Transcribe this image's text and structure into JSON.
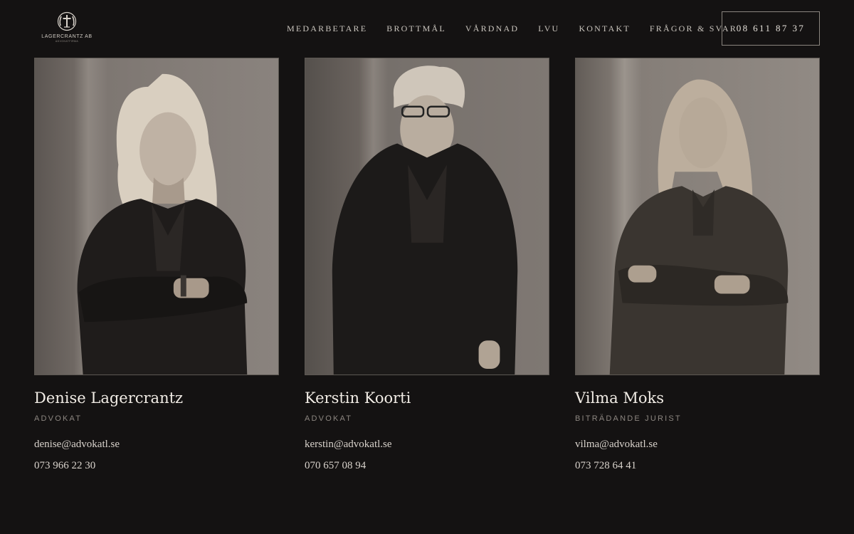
{
  "logo": {
    "name": "LAGERCRANTZ AB",
    "sub": "ADVOKATFIRMA",
    "icon": "laurel-cross-icon"
  },
  "nav": {
    "items": [
      {
        "label": "MEDARBETARE"
      },
      {
        "label": "BROTTMÅL"
      },
      {
        "label": "VÅRDNAD"
      },
      {
        "label": "LVU"
      },
      {
        "label": "KONTAKT"
      },
      {
        "label": "FRÅGOR & SVAR"
      }
    ]
  },
  "header": {
    "phone": "08 611 87 37"
  },
  "people": [
    {
      "name": "Denise Lagercrantz",
      "role": "ADVOKAT",
      "email": "denise@advokatl.se",
      "phone": "073 966 22 30"
    },
    {
      "name": "Kerstin Koorti",
      "role": "ADVOKAT",
      "email": "kerstin@advokatl.se",
      "phone": "070 657 08 94"
    },
    {
      "name": "Vilma Moks",
      "role": "BITRÄDANDE JURIST",
      "email": "vilma@advokatl.se",
      "phone": "073 728 64 41"
    }
  ],
  "colors": {
    "background": "#141212",
    "text": "#f1ece5",
    "muted": "#8c8680",
    "border": "#8a857f"
  }
}
